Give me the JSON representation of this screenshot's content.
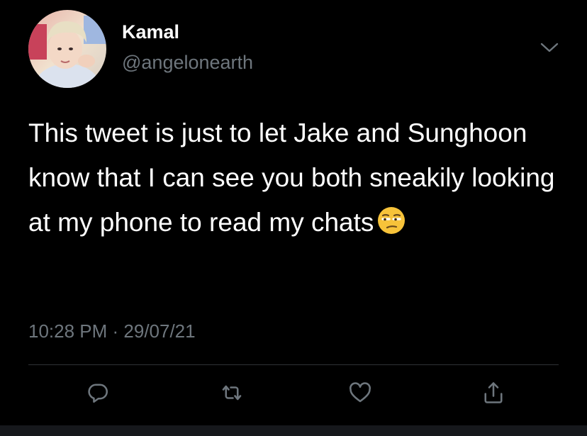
{
  "tweet": {
    "author": {
      "display_name": "Kamal",
      "handle": "@angelonearth"
    },
    "text": "This tweet is just to let Jake and Sunghoon know that I can see you both sneakily looking at my phone to read my chats",
    "emoji": "unamused-face",
    "timestamp": "10:28 PM · 29/07/21"
  },
  "actions": {
    "reply_icon": "reply-icon",
    "retweet_icon": "retweet-icon",
    "like_icon": "heart-icon",
    "share_icon": "share-icon"
  },
  "colors": {
    "background": "#000000",
    "text": "#ffffff",
    "secondary_text": "#6e767d",
    "divider": "#2f3336",
    "icon": "#6e767d",
    "emoji_face": "#f7c33a"
  }
}
